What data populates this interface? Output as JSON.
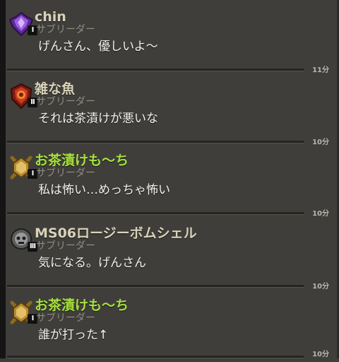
{
  "messages": [
    {
      "name": "chin",
      "name_color": "#d8d3b8",
      "rank": "I",
      "role": "サブリーダー",
      "text": "げんさん、優しいよ〜",
      "time": "11分",
      "badge": "purple-crest-icon"
    },
    {
      "name": "雑な魚",
      "name_color": "#d8d3b8",
      "rank": "II",
      "role": "サブリーダー",
      "text": "それは茶漬けが悪いな",
      "time": "10分",
      "badge": "red-crest-icon"
    },
    {
      "name": "お茶漬けも〜ち",
      "name_color": "#a6e03c",
      "rank": "I",
      "role": "サブリーダー",
      "text": "私は怖い…めっちゃ怖い",
      "time": "10分",
      "badge": "gold-crest-icon"
    },
    {
      "name": "MS06ロージーボムシェル",
      "name_color": "#d8d3b8",
      "rank": "III",
      "role": "サブリーダー",
      "text": "気になる。げんさん",
      "time": "10分",
      "badge": "skull-crest-icon"
    },
    {
      "name": "お茶漬けも〜ち",
      "name_color": "#a6e03c",
      "rank": "I",
      "role": "サブリーダー",
      "text": "誰が打った↑",
      "time": "10分",
      "badge": "gold-crest-icon"
    }
  ]
}
